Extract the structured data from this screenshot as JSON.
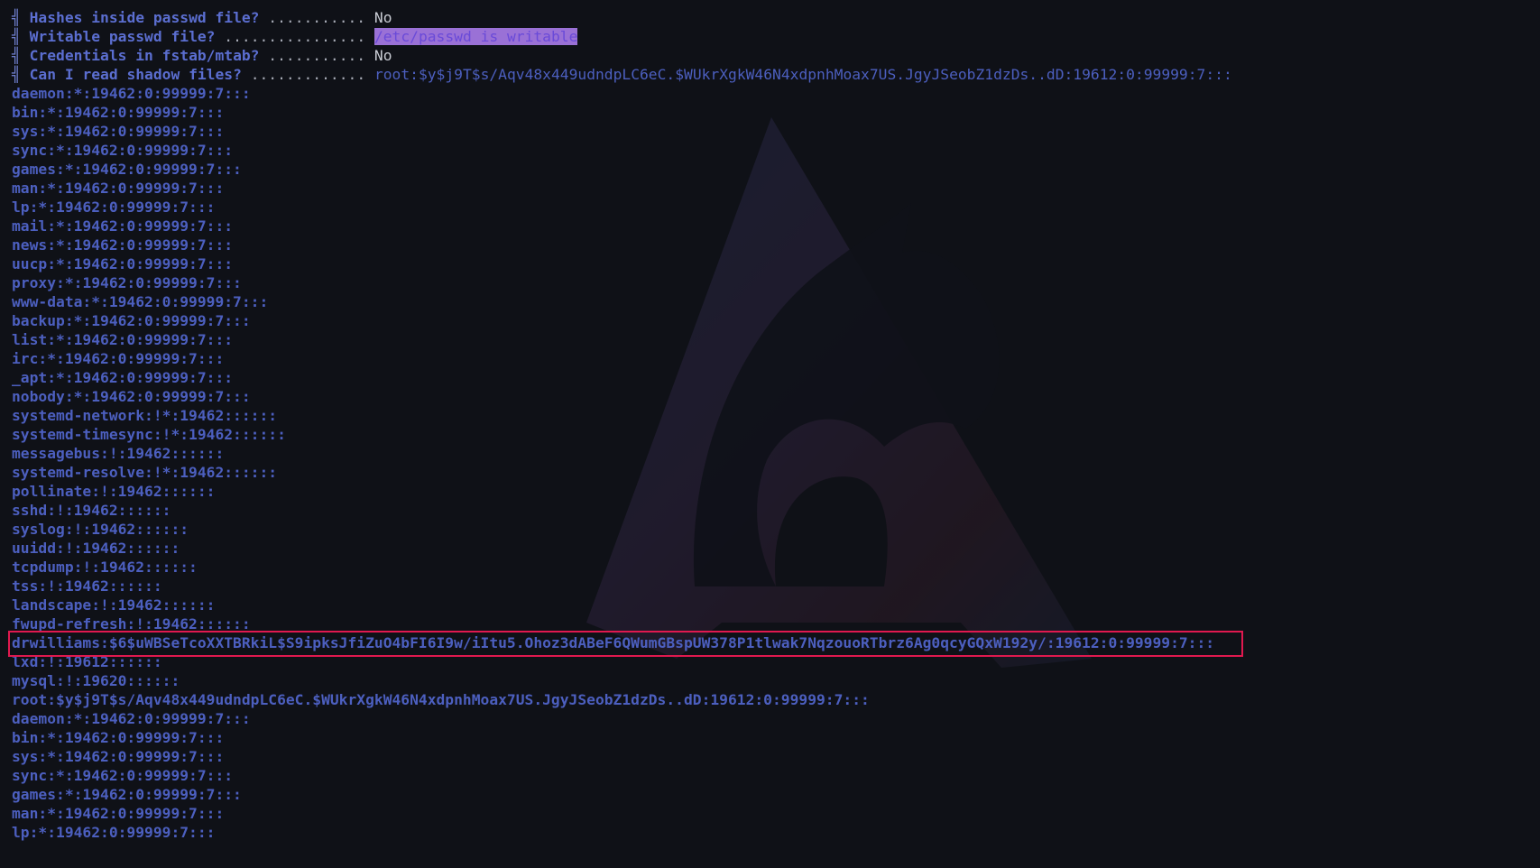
{
  "checks": [
    {
      "question": "Hashes inside passwd file?",
      "dots": " ........... ",
      "answer": "No",
      "style": "plain"
    },
    {
      "question": "Writable passwd file?",
      "dots": " ................ ",
      "answer": "/etc/passwd is writable",
      "style": "highlight"
    },
    {
      "question": "Credentials in fstab/mtab?",
      "dots": " ........... ",
      "answer": "No",
      "style": "plain"
    },
    {
      "question": "Can I read shadow files?",
      "dots": " ............. ",
      "answer": "root:$y$j9T$s/Aqv48x449udndpLC6eC.$WUkrXgkW46N4xdpnhMoax7US.JgyJSeobZ1dzDs..dD:19612:0:99999:7:::",
      "style": "blue"
    }
  ],
  "check_marker": "╣",
  "shadow_lines": [
    "daemon:*:19462:0:99999:7:::",
    "bin:*:19462:0:99999:7:::",
    "sys:*:19462:0:99999:7:::",
    "sync:*:19462:0:99999:7:::",
    "games:*:19462:0:99999:7:::",
    "man:*:19462:0:99999:7:::",
    "lp:*:19462:0:99999:7:::",
    "mail:*:19462:0:99999:7:::",
    "news:*:19462:0:99999:7:::",
    "uucp:*:19462:0:99999:7:::",
    "proxy:*:19462:0:99999:7:::",
    "www-data:*:19462:0:99999:7:::",
    "backup:*:19462:0:99999:7:::",
    "list:*:19462:0:99999:7:::",
    "irc:*:19462:0:99999:7:::",
    "_apt:*:19462:0:99999:7:::",
    "nobody:*:19462:0:99999:7:::",
    "systemd-network:!*:19462::::::",
    "systemd-timesync:!*:19462::::::",
    "messagebus:!:19462::::::",
    "systemd-resolve:!*:19462::::::",
    "pollinate:!:19462::::::",
    "sshd:!:19462::::::",
    "syslog:!:19462::::::",
    "uuidd:!:19462::::::",
    "tcpdump:!:19462::::::",
    "tss:!:19462::::::",
    "landscape:!:19462::::::",
    "fwupd-refresh:!:19462::::::",
    "drwilliams:$6$uWBSeTcoXXTBRkiL$S9ipksJfiZuO4bFI6I9w/iItu5.Ohoz3dABeF6QWumGBspUW378P1tlwak7NqzouoRTbrz6Ag0qcyGQxW192y/:19612:0:99999:7:::",
    "lxd:!:19612::::::",
    "mysql:!:19620::::::",
    "root:$y$j9T$s/Aqv48x449udndpLC6eC.$WUkrXgkW46N4xdpnhMoax7US.JgyJSeobZ1dzDs..dD:19612:0:99999:7:::",
    "daemon:*:19462:0:99999:7:::",
    "bin:*:19462:0:99999:7:::",
    "sys:*:19462:0:99999:7:::",
    "sync:*:19462:0:99999:7:::",
    "games:*:19462:0:99999:7:::",
    "man:*:19462:0:99999:7:::",
    "lp:*:19462:0:99999:7:::"
  ],
  "highlighted_line": "drwilliams:$6$uWBSeTcoXXTBRkiL$S9ipksJfiZuO4bFI6I9w/iItu5.Ohoz3dABeF6QWumGBspUW378P1tlwak7NqzouoRTbrz6Ag0qcyGQxW192y/:19612:0:99999:7:::",
  "background_icon": "dragon-logo-icon",
  "colors": {
    "background": "#0f1117",
    "text_blue": "#4c5fbf",
    "answer_plain": "#c9ccd4",
    "highlight_bg": "#9a71d6",
    "annotation_box": "#e0194f"
  }
}
